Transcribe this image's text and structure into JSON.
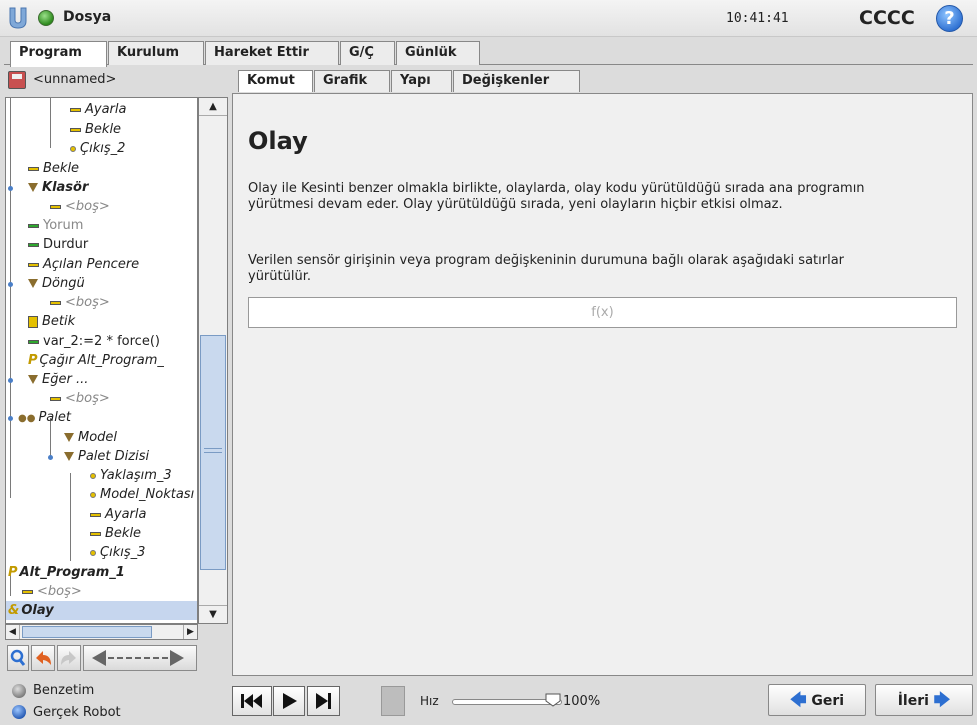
{
  "header": {
    "file_label": "Dosya",
    "time": "10:41:41",
    "robot_name": "CCCC",
    "help_icon": "question-mark-icon"
  },
  "main_tabs": [
    {
      "label": "Program",
      "active": true
    },
    {
      "label": "Kurulum",
      "active": false
    },
    {
      "label": "Hareket Ettir",
      "active": false
    },
    {
      "label": "G/Ç",
      "active": false
    },
    {
      "label": "Günlük",
      "active": false
    }
  ],
  "program": {
    "name": "<unnamed>"
  },
  "tree": [
    {
      "label": "Ayarla",
      "icon": "bar"
    },
    {
      "label": "Bekle",
      "icon": "bar"
    },
    {
      "label": "Çıkış_2",
      "icon": "dot"
    },
    {
      "label": "Bekle",
      "icon": "bar"
    },
    {
      "label": "Klasör",
      "icon": "folder"
    },
    {
      "label": "<boş>",
      "icon": "bar"
    },
    {
      "label": "Yorum",
      "icon": "bar-green"
    },
    {
      "label": "Durdur",
      "icon": "bar-green"
    },
    {
      "label": "Açılan Pencere",
      "icon": "bar"
    },
    {
      "label": "Döngü",
      "icon": "folder"
    },
    {
      "label": "<boş>",
      "icon": "bar"
    },
    {
      "label": "Betik",
      "icon": "script"
    },
    {
      "label": "var_2:=2 * force()",
      "icon": "bar-green"
    },
    {
      "label": "Çağır Alt_Program_",
      "icon": "call"
    },
    {
      "label": "Eğer ...",
      "icon": "folder"
    },
    {
      "label": "<boş>",
      "icon": "bar"
    },
    {
      "label": "Palet",
      "icon": "pallet"
    },
    {
      "label": "Model",
      "icon": "folder"
    },
    {
      "label": "Palet Dizisi",
      "icon": "folder"
    },
    {
      "label": "Yaklaşım_3",
      "icon": "dot"
    },
    {
      "label": "Model_Noktası",
      "icon": "dot"
    },
    {
      "label": "Ayarla",
      "icon": "bar"
    },
    {
      "label": "Bekle",
      "icon": "bar"
    },
    {
      "label": "Çıkış_3",
      "icon": "dot"
    },
    {
      "label": "Alt_Program_1",
      "icon": "call"
    },
    {
      "label": "<boş>",
      "icon": "bar"
    },
    {
      "label": "Olay",
      "icon": "event"
    }
  ],
  "sub_tabs": [
    {
      "label": "Komut",
      "active": true
    },
    {
      "label": "Grafik",
      "active": false
    },
    {
      "label": "Yapı",
      "active": false
    },
    {
      "label": "Değişkenler",
      "active": false
    }
  ],
  "content": {
    "title": "Olay",
    "paragraph1": "Olay ile Kesinti benzer olmakla birlikte, olaylarda, olay kodu yürütüldüğü sırada ana programın yürütmesi devam eder. Olay yürütüldüğü sırada, yeni olayların hiçbir etkisi olmaz.",
    "paragraph2": "Verilen sensör girişinin veya program değişkeninin durumuna bağlı olarak aşağıdaki satırlar yürütülür.",
    "expression_placeholder": "f(x)"
  },
  "footer": {
    "mode_simulation": "Benzetim",
    "mode_real": "Gerçek Robot",
    "speed_label": "Hız",
    "speed_value": "100%",
    "speed_fraction": 1.0,
    "back_label": "Geri",
    "next_label": "İleri"
  }
}
